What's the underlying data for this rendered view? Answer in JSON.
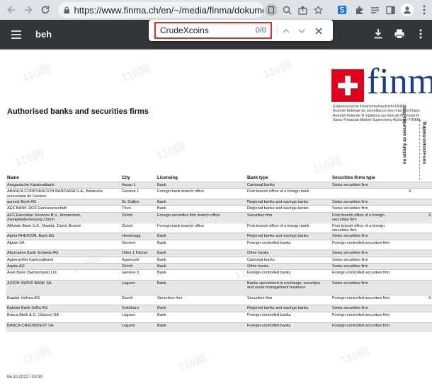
{
  "browser": {
    "url": "https://www.finma.ch/en/~/media/finma/dokume..."
  },
  "pdf_viewer": {
    "title": "beh"
  },
  "find_bar": {
    "query": "CrudeXcoins",
    "count": "0/0"
  },
  "document": {
    "title": "Authorised banks and securities firms",
    "logo_word": "finma",
    "logo_lines": [
      "Eidgenössische Finanzmarktaufsicht FINMA",
      "Autorité fédérale de surveillance des marchés financ",
      "Autorità federale di vigilanza sui mercati finanziari FI",
      "Swiss Financial Market Supervisory Authority FINMA"
    ],
    "watermark": "110网",
    "columns": {
      "name": "Name",
      "city": "City",
      "licensing": "Licensing",
      "bank_type": "Bank type",
      "securities_type": "Securities firms type",
      "no_activity": "no activity as securities firm",
      "non_account": "non-account-holding"
    },
    "rows": [
      {
        "name": "Aargauische Kantonalbank",
        "city": "Aarau 1",
        "licensing": "Bank",
        "bank_type": "Cantonal banks",
        "sec_type": "Swiss securities firm",
        "no_act": "",
        "non_acc": ""
      },
      {
        "name": "ABANCA CORPORACION BANCARIA S.A., Betanzos, succursale de Genève",
        "city": "Genève 1",
        "licensing": "Foreign bank branch office",
        "bank_type": "First branch office of a foreign bank",
        "sec_type": "",
        "no_act": "X",
        "non_acc": ""
      },
      {
        "name": "acrevis Bank AG",
        "city": "St. Gallen",
        "licensing": "Bank",
        "bank_type": "Regional banks and savings banks",
        "sec_type": "Swiss securities firm",
        "no_act": "",
        "non_acc": ""
      },
      {
        "name": "AEK BANK 1826 Genossenschaft",
        "city": "Thun",
        "licensing": "Bank",
        "bank_type": "Regional banks and savings banks",
        "sec_type": "Swiss securities firm",
        "no_act": "",
        "non_acc": ""
      },
      {
        "name": "AFS Execution Services B.V., Amsterdam, Zweigniederlassung Zürich",
        "city": "Zürich",
        "licensing": "Foreign securities firm branch office",
        "bank_type": "Securities firm",
        "sec_type": "First branch office of a foreign securities firm",
        "no_act": "",
        "non_acc": "X"
      },
      {
        "name": "Allfunds Bank S.A., Madrid, Zurich Branch",
        "city": "Zürich",
        "licensing": "Foreign bank branch office",
        "bank_type": "First branch office of a foreign bank",
        "sec_type": "First branch office of a foreign securities firm",
        "no_act": "",
        "non_acc": ""
      },
      {
        "name": "Alpha RHEINTAL Bank AG",
        "city": "Heerbrugg",
        "licensing": "Bank",
        "bank_type": "Regional banks and savings banks",
        "sec_type": "Swiss securities firm",
        "no_act": "",
        "non_acc": ""
      },
      {
        "name": "Alpian SA",
        "city": "Genève",
        "licensing": "Bank",
        "bank_type": "Foreign-controlled banks",
        "sec_type": "Foreign-controlled securities firm",
        "no_act": "",
        "non_acc": ""
      },
      {
        "name": "Alternative Bank Schweiz AG",
        "city": "Olten 1 Fächer",
        "licensing": "Bank",
        "bank_type": "Other banks",
        "sec_type": "Swiss securities firm",
        "no_act": "",
        "non_acc": ""
      },
      {
        "name": "Appenzeller Kantonalbank",
        "city": "Appenzell",
        "licensing": "Bank",
        "bank_type": "Cantonal banks",
        "sec_type": "Swiss securities firm",
        "no_act": "",
        "non_acc": ""
      },
      {
        "name": "Aquila AG",
        "city": "Zürich",
        "licensing": "Bank",
        "bank_type": "Other banks",
        "sec_type": "Swiss securities firm",
        "no_act": "",
        "non_acc": ""
      },
      {
        "name": "Arab Bank (Switzerland) Ltd.",
        "city": "Genève 3",
        "licensing": "Bank",
        "bank_type": "Foreign-controlled banks",
        "sec_type": "Foreign-controlled securities firm",
        "no_act": "",
        "non_acc": ""
      },
      {
        "name": "AXION SWISS BANK SA",
        "city": "Lugano",
        "licensing": "Bank",
        "bank_type": "Banks specialised in exchange, securities and asset management business",
        "sec_type": "Swiss securities firm",
        "no_act": "",
        "non_acc": ""
      },
      {
        "name": "Baader Helvea AG",
        "city": "Zürich",
        "licensing": "Securities firm",
        "bank_type": "Securities firm",
        "sec_type": "Foreign-controlled securities firm",
        "no_act": "",
        "non_acc": "X"
      },
      {
        "name": "Baloise Bank SoBa AG",
        "city": "Solothurn",
        "licensing": "Bank",
        "bank_type": "Regional banks and savings banks",
        "sec_type": "Swiss securities firm",
        "no_act": "",
        "non_acc": ""
      },
      {
        "name": "Banca Aletti & C. (Suisse) SA",
        "city": "Lugano",
        "licensing": "Bank",
        "bank_type": "Foreign-controlled banks",
        "sec_type": "Foreign-controlled securities firm",
        "no_act": "",
        "non_acc": ""
      },
      {
        "name": "BANCA CREDINVEST SA",
        "city": "Lugano",
        "licensing": "Bank",
        "bank_type": "Foreign-controlled banks",
        "sec_type": "Foreign-controlled securities firm",
        "no_act": "",
        "non_acc": ""
      }
    ],
    "footer_date": "06.10.2022 / 03:30"
  }
}
